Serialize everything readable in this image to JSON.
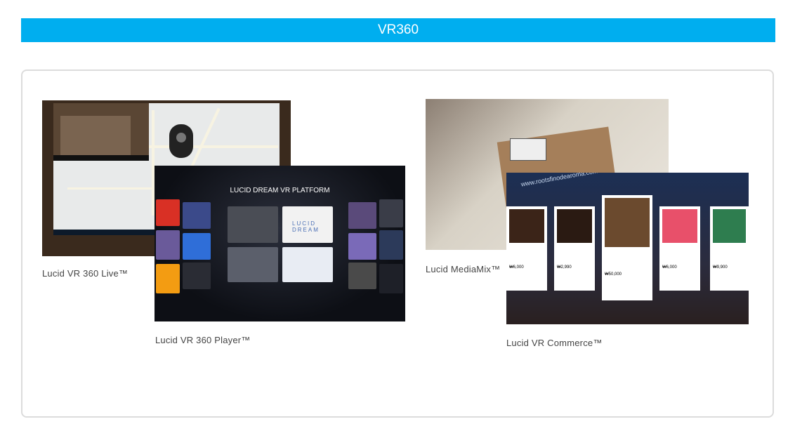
{
  "header": {
    "title": "VR360"
  },
  "products": [
    {
      "caption": "Lucid VR 360 Live™"
    },
    {
      "caption": "Lucid VR 360 Player™"
    },
    {
      "caption": "Lucid MediaMix™"
    },
    {
      "caption": "Lucid VR Commerce™"
    }
  ],
  "player_screen": {
    "title": "LUCID DREAM VR PLATFORM",
    "logo_text": "LUCID DREAM"
  },
  "commerce_screen": {
    "sign_text": "www.rootsfinodearoma.com",
    "prices": [
      "₩6,000",
      "₩2,990",
      "₩50,000",
      "₩6,000",
      "₩9,900"
    ]
  },
  "colors": {
    "banner": "#00aeef",
    "panel_border": "#dcdcdc",
    "caption": "#444444"
  }
}
